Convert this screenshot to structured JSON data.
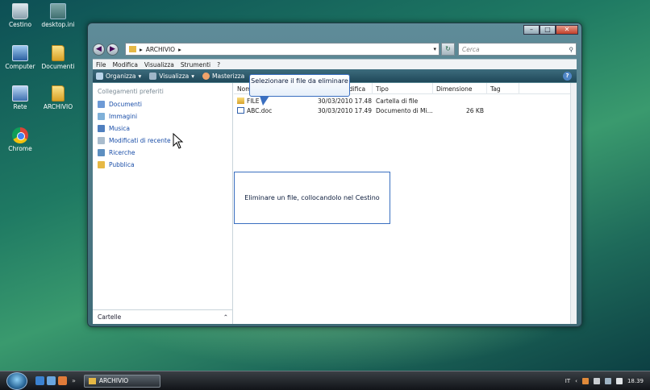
{
  "desktop": {
    "icons": [
      {
        "label": "Cestino",
        "icon": "recycle-bin-icon"
      },
      {
        "label": "desktop.ini",
        "icon": "ini-file-icon"
      },
      {
        "label": "Computer",
        "icon": "computer-icon"
      },
      {
        "label": "Documenti",
        "icon": "folder-icon"
      },
      {
        "label": "Rete",
        "icon": "network-icon"
      },
      {
        "label": "ARCHIVIO",
        "icon": "folder-icon"
      },
      {
        "label": "Chrome",
        "icon": "chrome-icon"
      }
    ]
  },
  "window": {
    "address": {
      "segment": "ARCHIVIO",
      "separator": "▸"
    },
    "search_placeholder": "Cerca",
    "menu": [
      "File",
      "Modifica",
      "Visualizza",
      "Strumenti",
      "?"
    ],
    "toolbar": {
      "organize": "Organizza",
      "views": "Visualizza",
      "burn": "Masterizza"
    },
    "nav": {
      "header": "Collegamenti preferiti",
      "items": [
        "Documenti",
        "Immagini",
        "Musica",
        "Modificati di recente",
        "Ricerche",
        "Pubblica"
      ],
      "folders_label": "Cartelle",
      "folders_chevron": "⌃"
    },
    "columns": [
      "Nome",
      "Ultima modifica",
      "Tipo",
      "Dimensione",
      "Tag"
    ],
    "files": [
      {
        "name": "FILE",
        "date": "30/03/2010 17.48",
        "type": "Cartella di file",
        "size": "",
        "tag": ""
      },
      {
        "name": "ABC.doc",
        "date": "30/03/2010 17.49",
        "type": "Documento di Mi...",
        "size": "26 KB",
        "tag": ""
      }
    ]
  },
  "overlays": {
    "tooltip": "Selezionare il file da eliminare",
    "callout": "Eliminare un file, collocandolo nel Cestino"
  },
  "taskbar": {
    "task_label": "ARCHIVIO",
    "quicklaunch_more": "»",
    "lang": "IT",
    "clock": "18.39"
  },
  "colors": {
    "accent": "#3a6fc0",
    "link": "#1a4ea8"
  }
}
